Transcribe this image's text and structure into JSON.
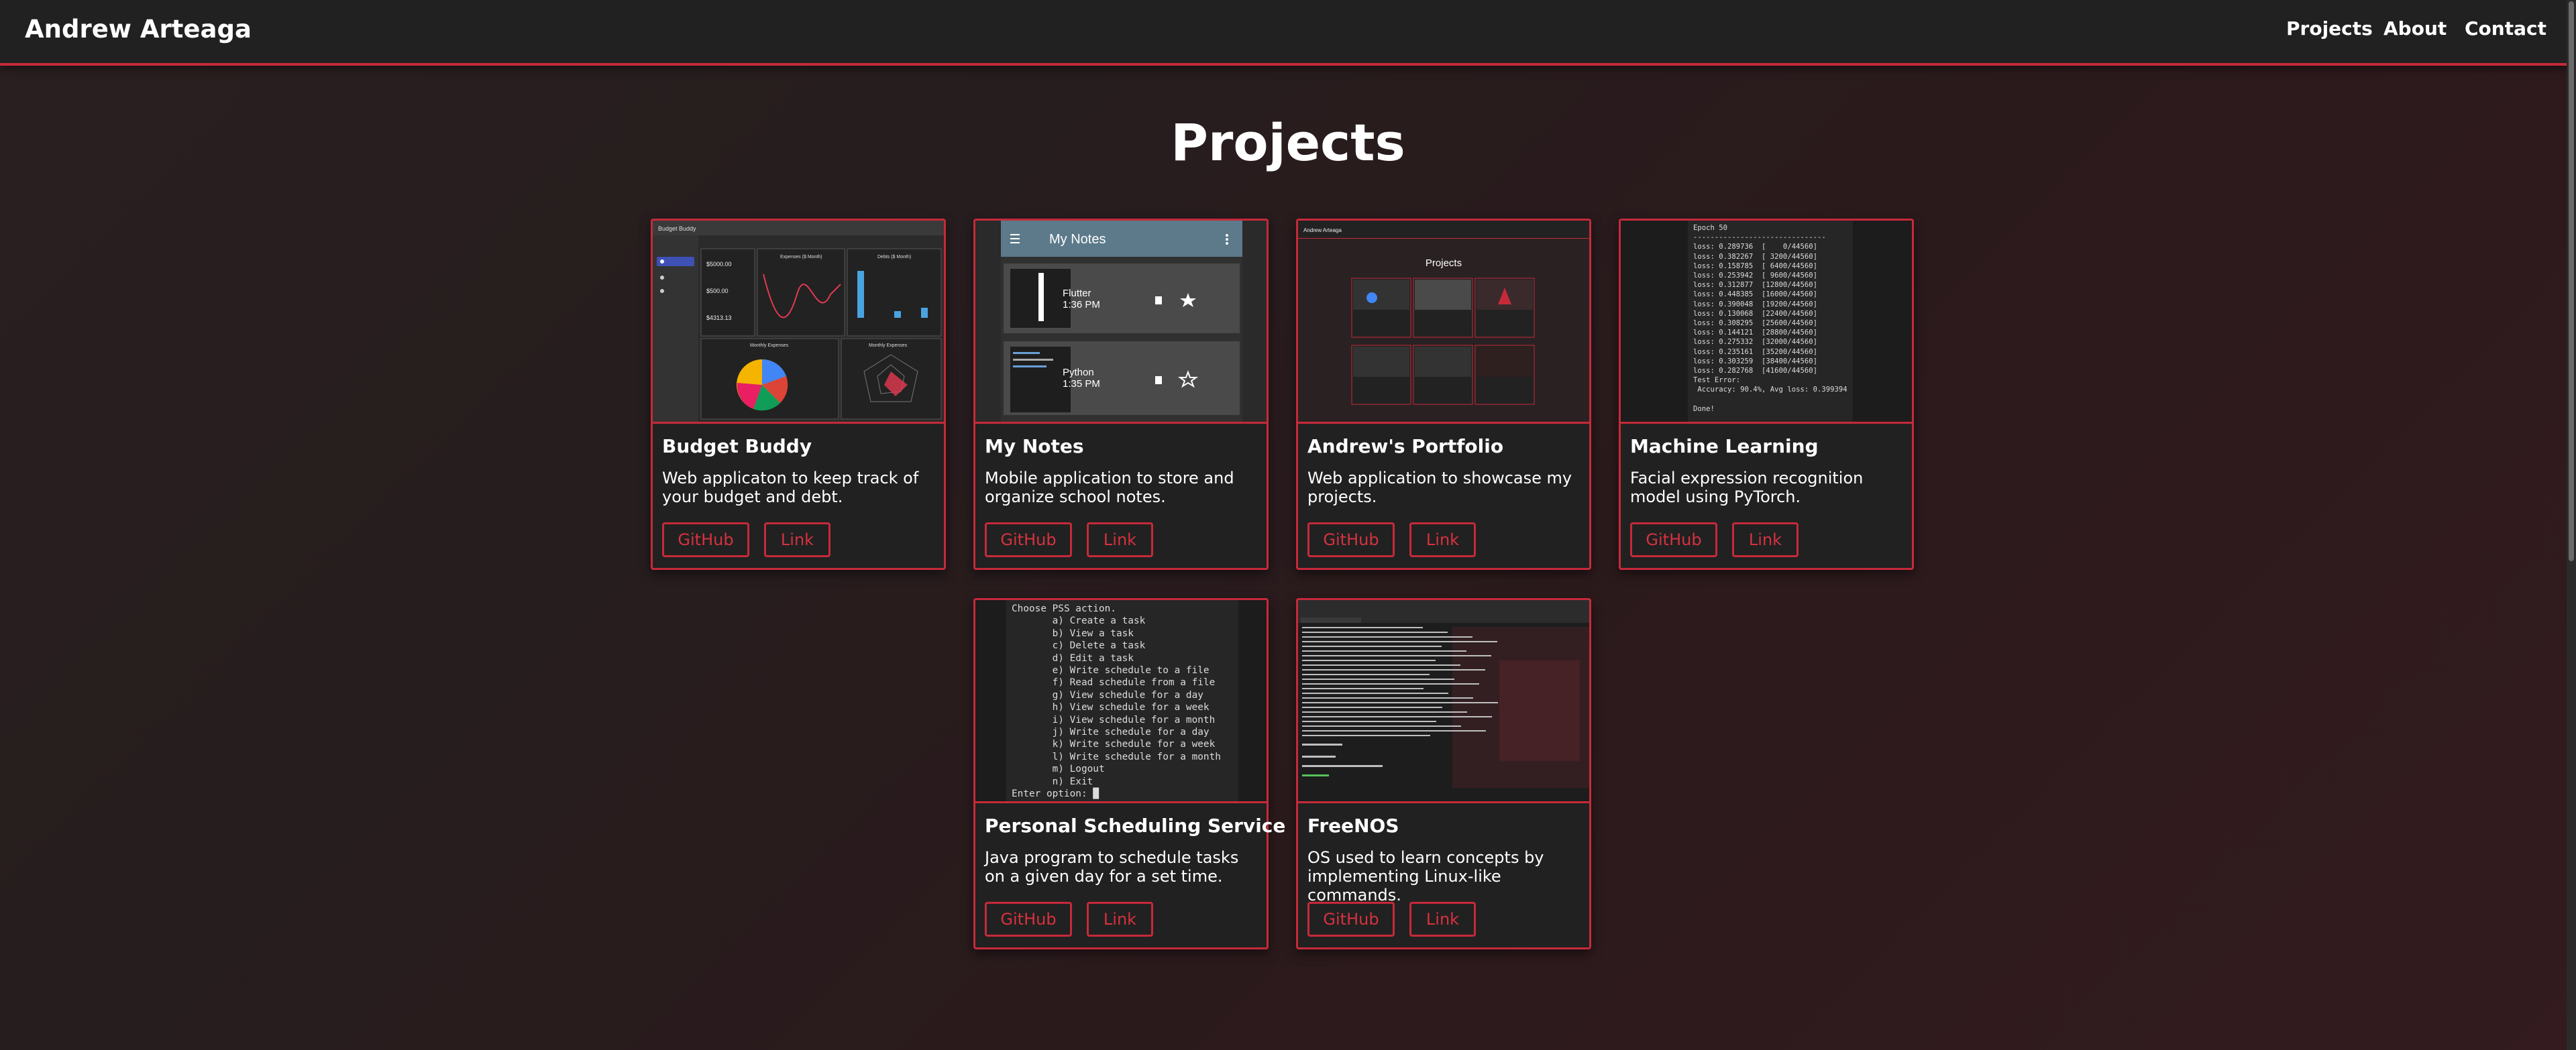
{
  "nav": {
    "brand": "Andrew Arteaga",
    "links": [
      "Projects",
      "About",
      "Contact"
    ]
  },
  "page": {
    "title": "Projects"
  },
  "projects": [
    {
      "title": "Budget Buddy",
      "description": "Web applicaton to keep track of your budget and debt.",
      "github": "GitHub",
      "link": "Link"
    },
    {
      "title": "My Notes",
      "description": "Mobile application to store and organize school notes.",
      "github": "GitHub",
      "link": "Link"
    },
    {
      "title": "Andrew's Portfolio",
      "description": "Web application to showcase my projects.",
      "github": "GitHub",
      "link": "Link"
    },
    {
      "title": "Machine Learning",
      "description": "Facial expression recognition model using PyTorch.",
      "github": "GitHub",
      "link": "Link"
    },
    {
      "title": "Personal Scheduling Service",
      "description": "Java program to schedule tasks on a given day for a set time.",
      "github": "GitHub",
      "link": "Link"
    },
    {
      "title": "FreeNOS",
      "description": "OS used to learn concepts by implementing Linux-like commands.",
      "github": "GitHub",
      "link": "Link"
    }
  ],
  "thumbnails": {
    "budget": {
      "app_title": "Budget Buddy",
      "chart_titles": [
        "Expenses ($ Month)",
        "Debts ($ Month)",
        "Monthly Expenses",
        "Monthly Expenses"
      ],
      "values": [
        "$5000.00",
        "$500.00",
        "$4313.13"
      ]
    },
    "notes": {
      "app_title": "My Notes",
      "items": [
        {
          "name": "Flutter",
          "time": "1:36 PM"
        },
        {
          "name": "Python",
          "time": "1:35 PM"
        }
      ]
    },
    "portfolio": {
      "brand": "Andrew Arteaga",
      "title": "Projects"
    },
    "ml": {
      "lines": [
        "Epoch 50",
        "-------------------------------",
        "loss: 0.289736  [    0/44560]",
        "loss: 0.382267  [ 3200/44560]",
        "loss: 0.158785  [ 6400/44560]",
        "loss: 0.253942  [ 9600/44560]",
        "loss: 0.312877  [12800/44560]",
        "loss: 0.448385  [16000/44560]",
        "loss: 0.390048  [19200/44560]",
        "loss: 0.130068  [22400/44560]",
        "loss: 0.308295  [25600/44560]",
        "loss: 0.144121  [28800/44560]",
        "loss: 0.275332  [32000/44560]",
        "loss: 0.235161  [35200/44560]",
        "loss: 0.303259  [38400/44560]",
        "loss: 0.282768  [41600/44560]",
        "Test Error:",
        " Accuracy: 90.4%, Avg loss: 0.399394",
        "",
        "Done!"
      ]
    },
    "scheduler": {
      "lines": [
        "Choose PSS action.",
        "       a) Create a task",
        "       b) View a task",
        "       c) Delete a task",
        "       d) Edit a task",
        "       e) Write schedule to a file",
        "       f) Read schedule from a file",
        "       g) View schedule for a day",
        "       h) View schedule for a week",
        "       i) View schedule for a month",
        "       j) Write schedule for a day",
        "       k) Write schedule for a week",
        "       l) Write schedule for a month",
        "       m) Logout",
        "       n) Exit",
        "Enter option: "
      ]
    }
  }
}
